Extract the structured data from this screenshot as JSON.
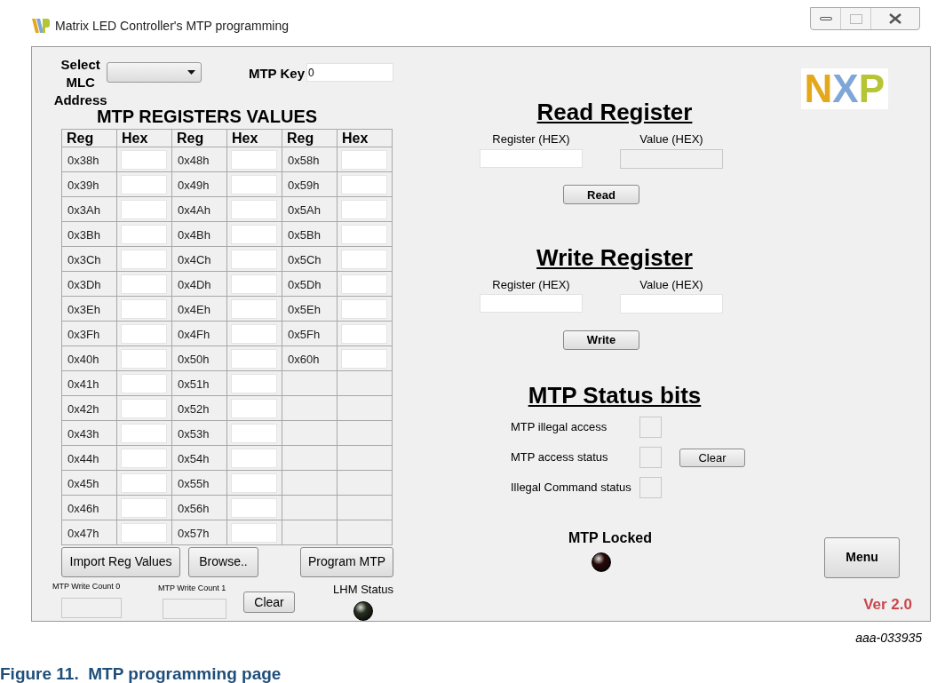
{
  "window": {
    "title": "Matrix LED Controller's MTP programming"
  },
  "address_select": {
    "label": "Select MLC Address"
  },
  "mtp_key": {
    "label": "MTP Key",
    "value": "0"
  },
  "registers": {
    "title": "MTP REGISTERS VALUES",
    "columns": [
      "Reg",
      "Hex",
      "Reg",
      "Hex",
      "Reg",
      "Hex"
    ],
    "rows": [
      [
        "0x38h",
        "",
        "0x48h",
        "",
        "0x58h",
        ""
      ],
      [
        "0x39h",
        "",
        "0x49h",
        "",
        "0x59h",
        ""
      ],
      [
        "0x3Ah",
        "",
        "0x4Ah",
        "",
        "0x5Ah",
        ""
      ],
      [
        "0x3Bh",
        "",
        "0x4Bh",
        "",
        "0x5Bh",
        ""
      ],
      [
        "0x3Ch",
        "",
        "0x4Ch",
        "",
        "0x5Ch",
        ""
      ],
      [
        "0x3Dh",
        "",
        "0x4Dh",
        "",
        "0x5Dh",
        ""
      ],
      [
        "0x3Eh",
        "",
        "0x4Eh",
        "",
        "0x5Eh",
        ""
      ],
      [
        "0x3Fh",
        "",
        "0x4Fh",
        "",
        "0x5Fh",
        ""
      ],
      [
        "0x40h",
        "",
        "0x50h",
        "",
        "0x60h",
        ""
      ],
      [
        "0x41h",
        "",
        "0x51h",
        "",
        "",
        ""
      ],
      [
        "0x42h",
        "",
        "0x52h",
        "",
        "",
        ""
      ],
      [
        "0x43h",
        "",
        "0x53h",
        "",
        "",
        ""
      ],
      [
        "0x44h",
        "",
        "0x54h",
        "",
        "",
        ""
      ],
      [
        "0x45h",
        "",
        "0x55h",
        "",
        "",
        ""
      ],
      [
        "0x46h",
        "",
        "0x56h",
        "",
        "",
        ""
      ],
      [
        "0x47h",
        "",
        "0x57h",
        "",
        "",
        ""
      ]
    ]
  },
  "table_buttons": [
    "Import Reg Values",
    "Browse..",
    "Program MTP"
  ],
  "write_counts": [
    "MTP Write Count 0",
    "MTP Write Count 1"
  ],
  "clear_counts_button": "Clear",
  "lhm_status": {
    "label": "LHM Status",
    "on": false
  },
  "logo": {
    "letters": [
      {
        "text": "N",
        "color": "#e4a81c"
      },
      {
        "text": "X",
        "color": "#7ea6d8"
      },
      {
        "text": "P",
        "color": "#b5c534"
      }
    ]
  },
  "read_register": {
    "title": "Read Register",
    "register_label": "Register (HEX)",
    "value_label": "Value (HEX)",
    "value_disabled": true,
    "button": "Read"
  },
  "write_register": {
    "title": "Write Register",
    "register_label": "Register (HEX)",
    "value_label": "Value (HEX)",
    "value_disabled": false,
    "button": "Write"
  },
  "status_bits": {
    "title": "MTP Status bits",
    "items": [
      {
        "label": "MTP illegal access"
      },
      {
        "label": "MTP access status"
      },
      {
        "label": "Illegal Command status"
      }
    ],
    "clear_button": "Clear"
  },
  "mtp_locked": {
    "label": "MTP Locked",
    "on": false
  },
  "menu_button": "Menu",
  "version": "Ver 2.0",
  "figure_id": "aaa-033935",
  "caption": "Figure 11.  MTP programming page"
}
